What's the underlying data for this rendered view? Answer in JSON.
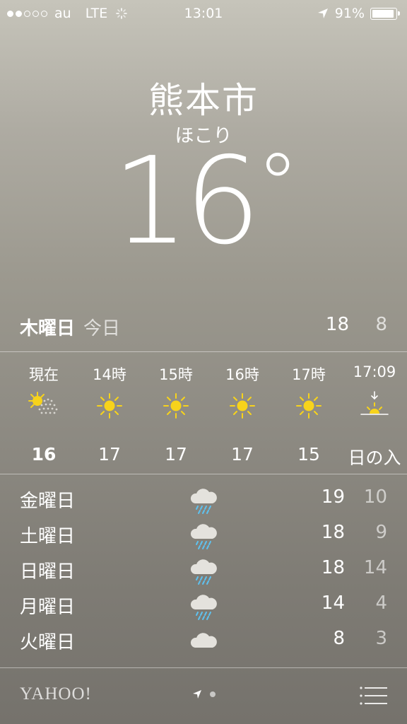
{
  "status_bar": {
    "carrier": "au",
    "network": "LTE",
    "time": "13:01",
    "battery": "91%",
    "signal_bars": 2,
    "battery_level": 0.91
  },
  "location": {
    "city": "熊本市",
    "condition": "ほこり",
    "temperature": "16",
    "degree": "°"
  },
  "today": {
    "day": "木曜日",
    "label": "今日",
    "high": "18",
    "low": "8"
  },
  "hourly": [
    {
      "time": "現在",
      "icon": "sun-dust-icon",
      "temp": "16"
    },
    {
      "time": "14時",
      "icon": "sun-icon",
      "temp": "17"
    },
    {
      "time": "15時",
      "icon": "sun-icon",
      "temp": "17"
    },
    {
      "time": "16時",
      "icon": "sun-icon",
      "temp": "17"
    },
    {
      "time": "17時",
      "icon": "sun-icon",
      "temp": "15"
    },
    {
      "time": "17:09",
      "icon": "sunset-icon",
      "temp": "日の入"
    }
  ],
  "daily": [
    {
      "day": "金曜日",
      "icon": "rain-cloud-icon",
      "high": "19",
      "low": "10"
    },
    {
      "day": "土曜日",
      "icon": "rain-cloud-icon",
      "high": "18",
      "low": "9"
    },
    {
      "day": "日曜日",
      "icon": "rain-cloud-icon",
      "high": "18",
      "low": "14"
    },
    {
      "day": "月曜日",
      "icon": "rain-cloud-icon",
      "high": "14",
      "low": "4"
    },
    {
      "day": "火曜日",
      "icon": "cloud-icon",
      "high": "8",
      "low": "3"
    }
  ],
  "footer": {
    "brand": "YAHOO!"
  },
  "colors": {
    "sun": "#f7d31b",
    "rain": "#5ec2f0"
  }
}
